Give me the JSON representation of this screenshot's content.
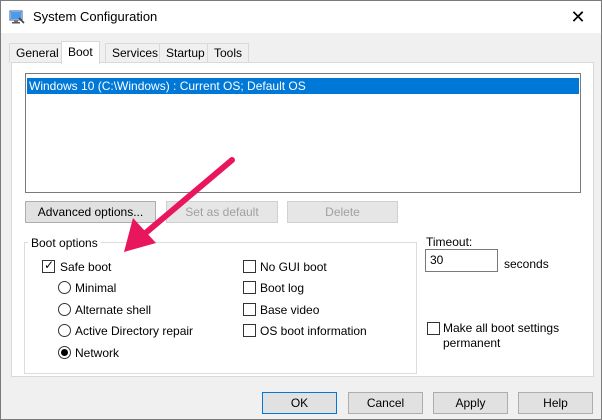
{
  "window": {
    "title": "System Configuration",
    "close_glyph": "✕"
  },
  "tabs": [
    {
      "label": "General"
    },
    {
      "label": "Boot",
      "active": true
    },
    {
      "label": "Services"
    },
    {
      "label": "Startup"
    },
    {
      "label": "Tools"
    }
  ],
  "os_list": {
    "items": [
      {
        "label": "Windows 10 (C:\\Windows) : Current OS; Default OS",
        "selected": true
      }
    ]
  },
  "os_buttons": {
    "advanced": "Advanced options...",
    "set_default": "Set as default",
    "delete": "Delete"
  },
  "boot_options": {
    "title": "Boot options",
    "safe_boot": {
      "label": "Safe boot",
      "checked": true
    },
    "radios": [
      {
        "label": "Minimal",
        "selected": false
      },
      {
        "label": "Alternate shell",
        "selected": false
      },
      {
        "label": "Active Directory repair",
        "selected": false
      },
      {
        "label": "Network",
        "selected": true
      }
    ],
    "checks": [
      {
        "label": "No GUI boot",
        "checked": false
      },
      {
        "label": "Boot log",
        "checked": false
      },
      {
        "label": "Base video",
        "checked": false
      },
      {
        "label": "OS boot information",
        "checked": false
      }
    ]
  },
  "timeout": {
    "label": "Timeout:",
    "value": "30",
    "unit": "seconds"
  },
  "make_permanent": {
    "line1": "Make all boot settings",
    "line2": "permanent",
    "checked": false
  },
  "footer": {
    "ok": "OK",
    "cancel": "Cancel",
    "apply": "Apply",
    "help": "Help"
  },
  "colors": {
    "selection": "#0078d7",
    "annotation_arrow": "#e8175d"
  },
  "icons": {
    "app": "system-config-icon",
    "close": "close-icon",
    "check": "checkmark-icon",
    "arrow": "annotation-arrow"
  }
}
